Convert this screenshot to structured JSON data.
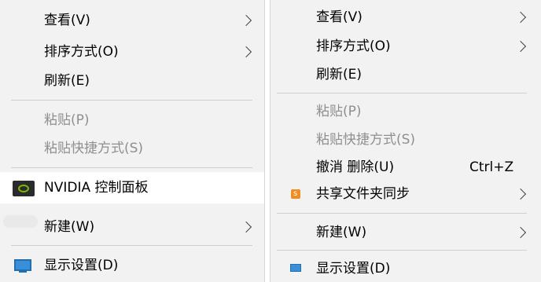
{
  "left_menu": {
    "view": "查看(V)",
    "sort_by": "排序方式(O)",
    "refresh": "刷新(E)",
    "paste": "粘贴(P)",
    "paste_shortcut": "粘贴快捷方式(S)",
    "nvidia": "NVIDIA 控制面板",
    "new": "新建(W)",
    "display_settings": "显示设置(D)"
  },
  "right_menu": {
    "view": "查看(V)",
    "sort_by": "排序方式(O)",
    "refresh": "刷新(E)",
    "paste": "粘贴(P)",
    "paste_shortcut": "粘贴快捷方式(S)",
    "undo_delete": "撤消 删除(U)",
    "undo_shortcut": "Ctrl+Z",
    "share_sync": "共享文件夹同步",
    "new": "新建(W)",
    "display_settings": "显示设置(D)"
  },
  "icons": {
    "nvidia": "nvidia-icon",
    "monitor": "monitor-icon",
    "share": "share-sync-icon",
    "chevron": "chevron-right-icon"
  },
  "colors": {
    "menu_bg": "#f2f2f2",
    "highlight_bg": "#ffffff",
    "disabled_text": "#8f8f8f",
    "nvidia_green": "#76b900",
    "monitor_blue": "#3a8fd8",
    "share_orange": "#f28b20"
  }
}
